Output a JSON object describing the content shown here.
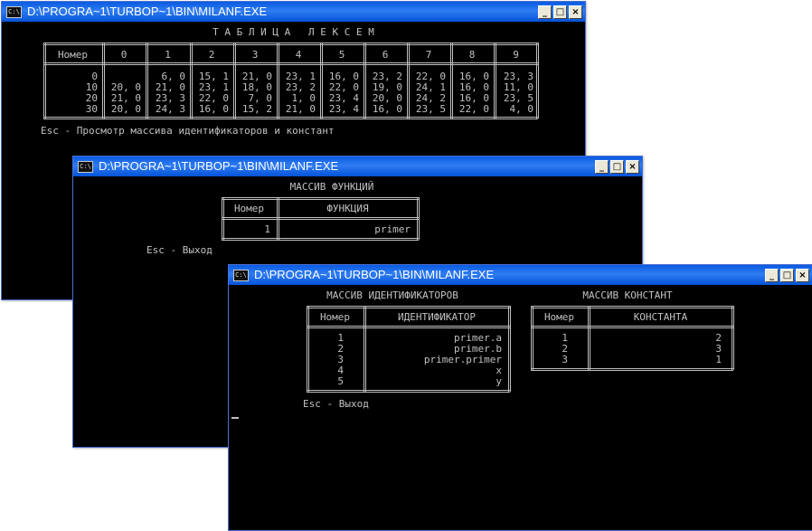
{
  "window_title": "D:\\PROGRA~1\\TURBOP~1\\BIN\\MILANF.EXE",
  "sysicon_text": "C:\\",
  "btn_min": "_",
  "btn_max": "□",
  "btn_close": "×",
  "w1": {
    "heading": "Т А Б Л И Ц А   Л Е К С Е М",
    "header": [
      "Номер",
      "0",
      "1",
      "2",
      "3",
      "4",
      "5",
      "6",
      "7",
      "8",
      "9"
    ],
    "rows": [
      [
        "0",
        "",
        "6, 0",
        "15, 1",
        "21, 0",
        "23, 1",
        "16, 0",
        "23, 2",
        "22, 0",
        "16, 0",
        "23, 3"
      ],
      [
        "10",
        "20, 0",
        "21, 0",
        "23, 1",
        "18, 0",
        "23, 2",
        "22, 0",
        "19, 0",
        "24, 1",
        "16, 0",
        "11, 0"
      ],
      [
        "20",
        "21, 0",
        "23, 3",
        "22, 0",
        "7, 0",
        "1, 0",
        "23, 4",
        "20, 0",
        "24, 2",
        "16, 0",
        "23, 5"
      ],
      [
        "30",
        "20, 0",
        "24, 3",
        "16, 0",
        "15, 2",
        "21, 0",
        "23, 4",
        "16, 0",
        "23, 5",
        "22, 0",
        "4, 0"
      ]
    ],
    "footer": "Esc - Просмотр массива идентификаторов и констант"
  },
  "w2": {
    "heading": "МАССИВ ФУНКЦИЙ",
    "header": [
      "Номер",
      "ФУНКЦИЯ"
    ],
    "rows": [
      [
        "1",
        "primer"
      ]
    ],
    "footer": "Esc - Выход"
  },
  "w3": {
    "ident": {
      "heading": "МАССИВ ИДЕНТИФИКАТОРОВ",
      "header": [
        "Номер",
        "ИДЕНТИФИКАТОР"
      ],
      "rows": [
        [
          "1",
          "primer.a"
        ],
        [
          "2",
          "primer.b"
        ],
        [
          "3",
          "primer.primer"
        ],
        [
          "4",
          "x"
        ],
        [
          "5",
          "y"
        ]
      ]
    },
    "const": {
      "heading": "МАССИВ КОНСТАНТ",
      "header": [
        "Номер",
        "КОНСТАНТА"
      ],
      "rows": [
        [
          "1",
          "2"
        ],
        [
          "2",
          "3"
        ],
        [
          "3",
          "1"
        ]
      ]
    },
    "footer": "Esc - Выход"
  }
}
